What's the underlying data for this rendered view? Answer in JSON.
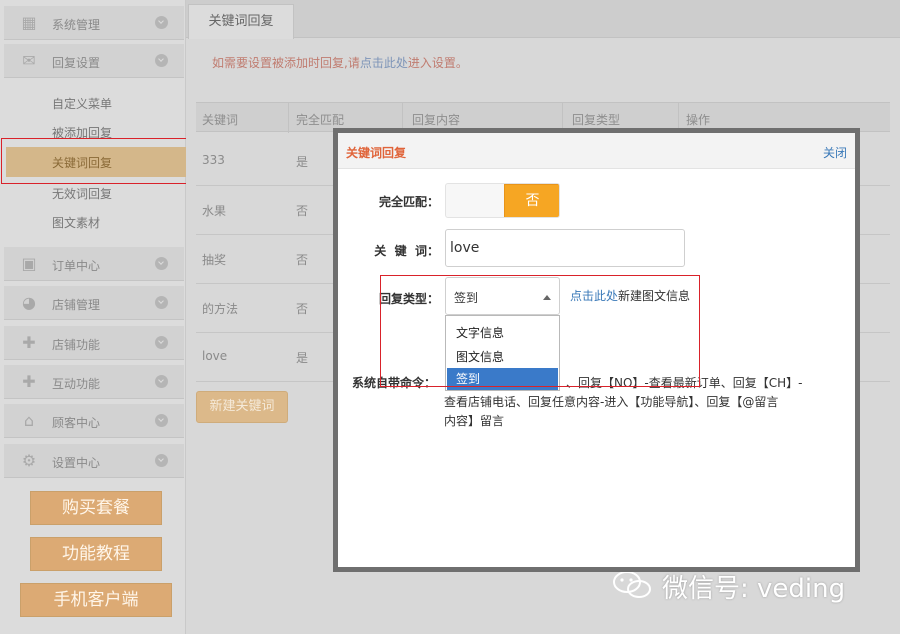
{
  "sidebar": {
    "sections": [
      {
        "label": "系统管理",
        "icon": "grid-icon"
      },
      {
        "label": "回复设置",
        "icon": "mail-icon"
      },
      {
        "label": "订单中心",
        "icon": "printer-icon"
      },
      {
        "label": "店铺管理",
        "icon": "pie-chart-icon"
      },
      {
        "label": "店铺功能",
        "icon": "plus-icon"
      },
      {
        "label": "互动功能",
        "icon": "plus-icon"
      },
      {
        "label": "顾客中心",
        "icon": "inbox-icon"
      },
      {
        "label": "设置中心",
        "icon": "gear-icon"
      }
    ],
    "sub_items": [
      "自定义菜单",
      "被添加回复",
      "关键词回复",
      "无效词回复",
      "图文素材"
    ],
    "active_sub": "关键词回复",
    "buttons": [
      "购买套餐",
      "功能教程",
      "手机客户端"
    ]
  },
  "content": {
    "tab": "关键词回复",
    "notice_prefix": "如需要设置被添加时回复,请",
    "notice_link": "点击此处",
    "notice_suffix": "进入设置。",
    "table": {
      "headers": [
        "关键词",
        "完全匹配",
        "回复内容",
        "回复类型",
        "操作"
      ],
      "rows": [
        {
          "keyword": "333",
          "exact": "是"
        },
        {
          "keyword": "水果",
          "exact": "否"
        },
        {
          "keyword": "抽奖",
          "exact": "否"
        },
        {
          "keyword": "的方法",
          "exact": "否"
        },
        {
          "keyword": "love",
          "exact": "是"
        }
      ]
    },
    "new_button": "新建关键词"
  },
  "modal": {
    "title": "关键词回复",
    "close": "关闭",
    "exact_label": "完全匹配：",
    "exact_value": "否",
    "keyword_label": "关  键  词：",
    "keyword_value": "love",
    "reply_type_label": "回复类型：",
    "reply_type_value": "签到",
    "reply_type_options": [
      "文字信息",
      "图文信息",
      "签到"
    ],
    "create_link": "点击此处",
    "create_suffix": "新建图文信息",
    "system_label": "系统自带命令：",
    "system_line1": "、回复【NO】-查看最新订单、回复【CH】-",
    "system_line2": "查看店铺电话、回复任意内容-进入【功能导航】、回复【@留言",
    "system_line3": "内容】留言"
  },
  "watermark": {
    "text": "微信号: veding",
    "icon": "wechat-icon"
  }
}
